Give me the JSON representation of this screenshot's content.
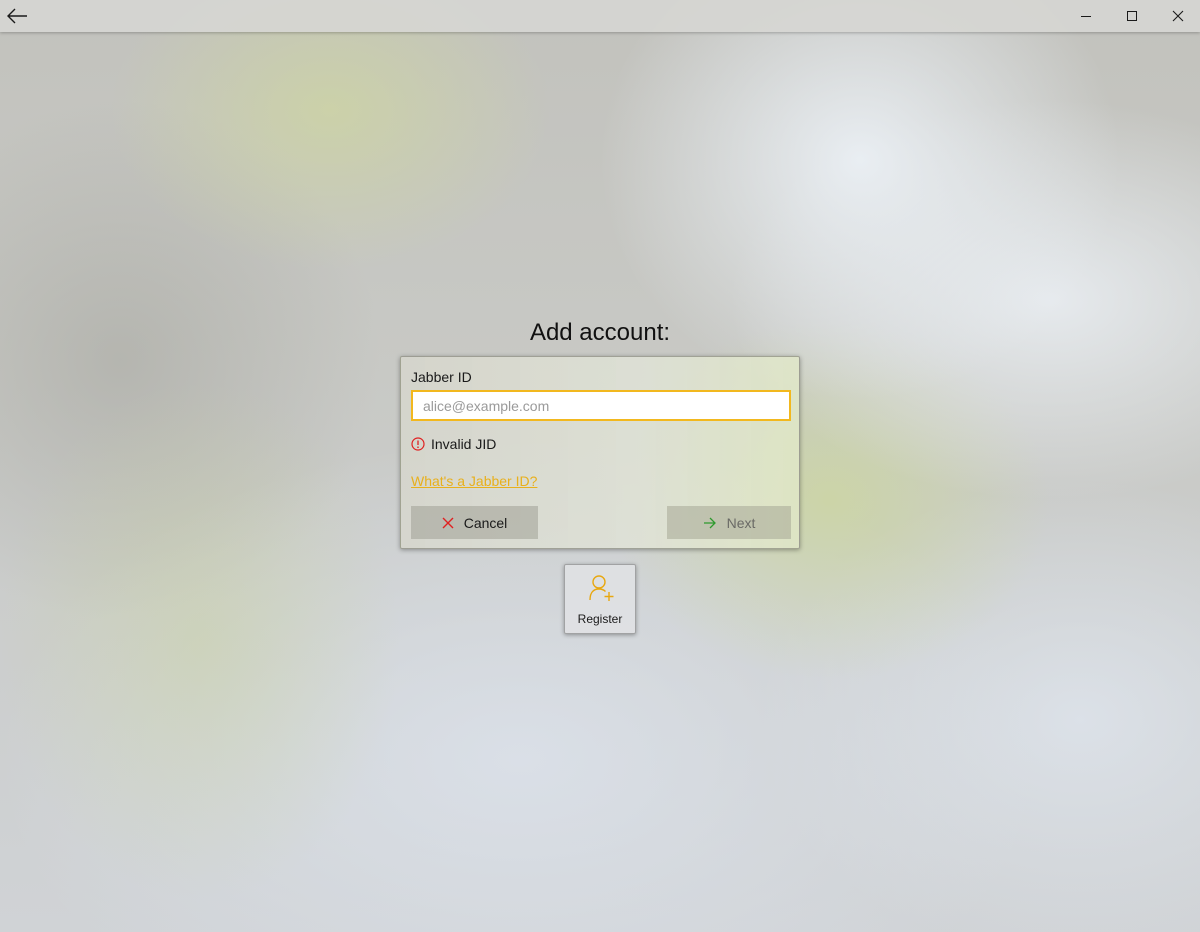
{
  "window": {
    "back_icon": "back-arrow-icon",
    "minimize_icon": "minimize-icon",
    "maximize_icon": "maximize-icon",
    "close_icon": "close-icon"
  },
  "heading": "Add account:",
  "form": {
    "jid_label": "Jabber ID",
    "jid_value": "",
    "jid_placeholder": "alice@example.com",
    "error_icon": "error-circle-icon",
    "error_text": "Invalid JID",
    "help_link": "What's a Jabber ID?",
    "cancel_icon": "close-x-icon",
    "cancel_label": "Cancel",
    "next_icon": "arrow-right-icon",
    "next_label": "Next"
  },
  "register": {
    "icon": "add-user-icon",
    "label": "Register"
  },
  "colors": {
    "accent": "#f2b81e",
    "error": "#e02020",
    "next_arrow": "#2e9a2e"
  }
}
